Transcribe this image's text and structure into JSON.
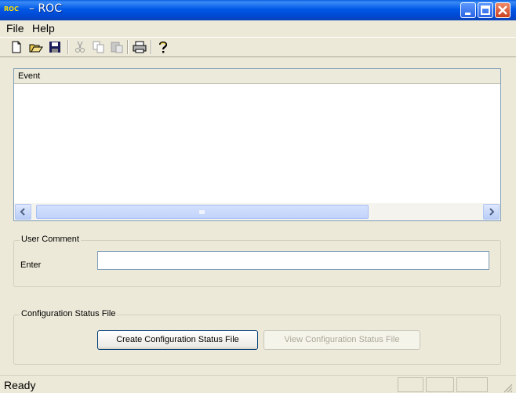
{
  "window": {
    "logo_text": "ROC",
    "title": "– ROC"
  },
  "menu": {
    "items": [
      {
        "label": "File"
      },
      {
        "label": "Help"
      }
    ]
  },
  "toolbar": {
    "buttons": [
      "new-icon",
      "open-icon",
      "save-icon",
      "cut-icon",
      "copy-icon",
      "paste-icon",
      "print-icon",
      "help-icon"
    ]
  },
  "event_list": {
    "column_header": "Event",
    "rows": []
  },
  "user_comment": {
    "group_title": "User Comment",
    "enter_label": "Enter",
    "input_value": ""
  },
  "config_status": {
    "group_title": "Configuration Status File",
    "create_button": "Create Configuration Status File",
    "view_button": "View Configuration Status File"
  },
  "statusbar": {
    "text": "Ready"
  },
  "colors": {
    "titlebar": "#0058e6",
    "window_bg": "#ece9d8",
    "logo": "#ffe000"
  }
}
